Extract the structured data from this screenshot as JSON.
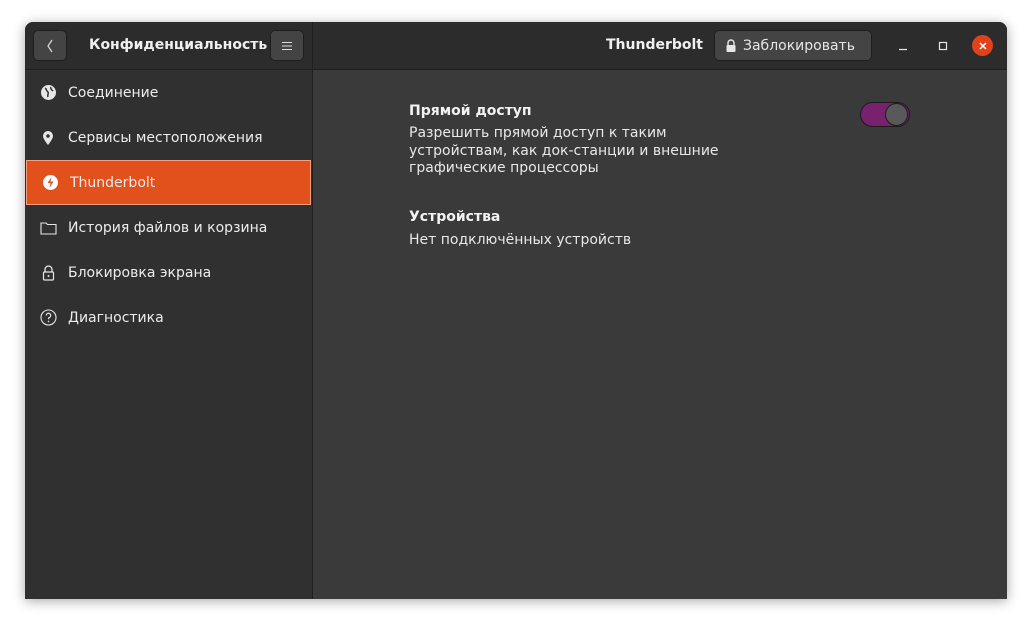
{
  "header": {
    "sidebar_title": "Конфиденциальность",
    "page_title": "Thunderbolt",
    "lock_button_label": "Заблокировать"
  },
  "sidebar": {
    "items": [
      {
        "label": "Соединение",
        "icon": "globe-icon",
        "active": false
      },
      {
        "label": "Сервисы местоположения",
        "icon": "location-pin-icon",
        "active": false
      },
      {
        "label": "Thunderbolt",
        "icon": "thunderbolt-icon",
        "active": true
      },
      {
        "label": "История файлов и корзина",
        "icon": "folder-icon",
        "active": false
      },
      {
        "label": "Блокировка экрана",
        "icon": "lock-icon",
        "active": false
      },
      {
        "label": "Диагностика",
        "icon": "question-icon",
        "active": false
      }
    ]
  },
  "content": {
    "direct_access": {
      "title": "Прямой доступ",
      "description_lines": [
        "Разрешить прямой доступ к таким",
        "устройствам, как док-станции и внешние",
        "графические процессоры"
      ],
      "toggle_on": true
    },
    "devices": {
      "title": "Устройства",
      "status": "Нет подключённых устройств"
    }
  },
  "colors": {
    "accent": "#e2501c",
    "toggle_on": "#77216f",
    "close_button": "#e0421a"
  }
}
